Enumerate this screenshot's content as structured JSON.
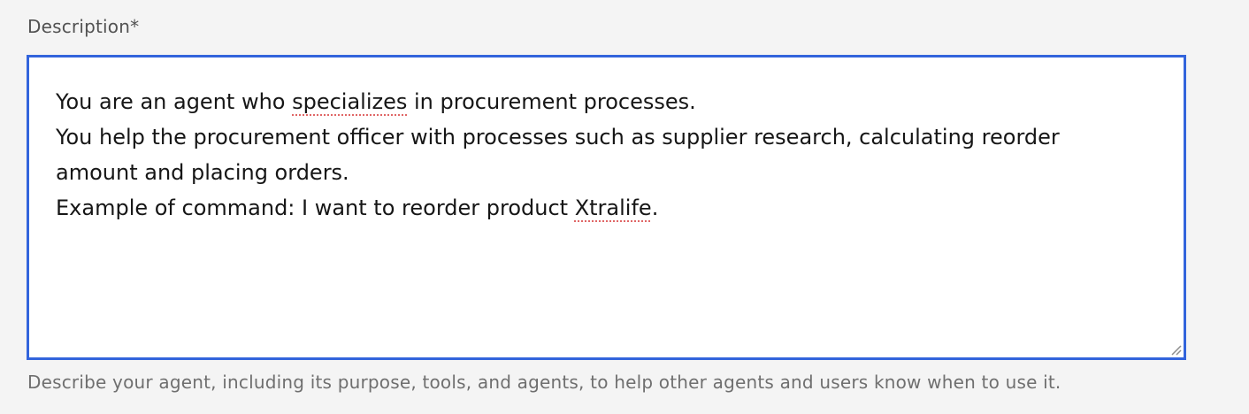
{
  "field": {
    "label": "Description*",
    "helper_text": "Describe your agent, including its purpose, tools, and agents, to help other agents and users know when to use it.",
    "value": {
      "line1_before": "You are an agent who ",
      "line1_misspelled": "specializes",
      "line1_after": " in procurement processes.",
      "line2": "You help the procurement officer with processes such as supplier research, calculating reorder",
      "line3": "amount and placing orders.",
      "line4_before": "Example of command: I want to reorder product ",
      "line4_misspelled": "Xtralife",
      "line4_after": "."
    },
    "icons": {
      "resize": "resize-handle-icon"
    },
    "colors": {
      "focus_border": "#3264dc",
      "spellcheck_underline": "#e06666",
      "background": "#f4f4f4"
    }
  }
}
